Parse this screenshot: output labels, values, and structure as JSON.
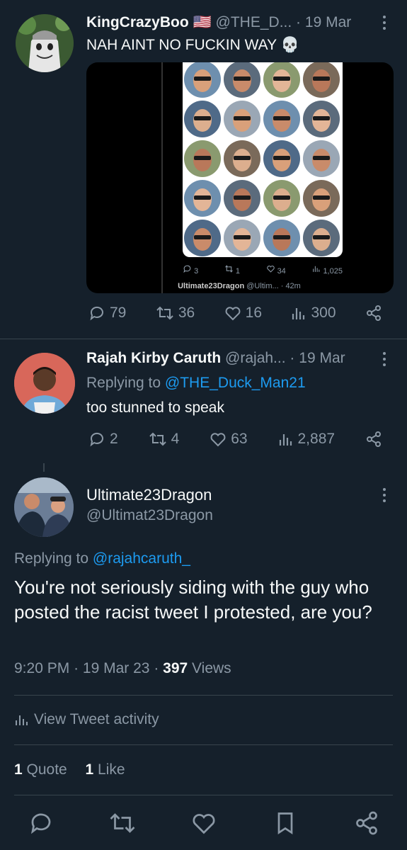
{
  "tweet1": {
    "display_name": "KingCrazyBoo",
    "flag": "🇺🇸",
    "handle": "@THE_D...",
    "dot": "·",
    "date": "19 Mar",
    "text": "NAH AINT NO FUCKIN WAY 💀",
    "embedded": {
      "stats": {
        "replies": "3",
        "retweets": "1",
        "likes": "34",
        "views": "1,025"
      },
      "next_name": "Ultimate23Dragon",
      "next_handle": "@Ultim...",
      "next_time": "· 42m"
    },
    "stats": {
      "replies": "79",
      "retweets": "36",
      "likes": "16",
      "views": "300"
    }
  },
  "tweet2": {
    "display_name": "Rajah Kirby Caruth",
    "handle": "@rajah...",
    "dot": "·",
    "date": "19 Mar",
    "replying_prefix": "Replying to",
    "replying_handle": "@THE_Duck_Man21",
    "text": "too stunned to speak",
    "stats": {
      "replies": "2",
      "retweets": "4",
      "likes": "63",
      "views": "2,887"
    }
  },
  "main": {
    "display_name": "Ultimate23Dragon",
    "handle": "@Ultimat23Dragon",
    "replying_prefix": "Replying to",
    "replying_handle": "@rajahcaruth_",
    "text": "You're not seriously siding with the guy who posted the racist tweet I protested, are you?",
    "time": "9:20 PM",
    "date": "19 Mar 23",
    "dot": "·",
    "views_count": "397",
    "views_label": "Views",
    "activity_label": "View Tweet activity",
    "quote_count": "1",
    "quote_label": "Quote",
    "like_count": "1",
    "like_label": "Like"
  },
  "colors": {
    "background": "#15202b",
    "text": "#f7f9f9",
    "muted": "#8b98a5",
    "link": "#1d9bf0",
    "border": "#38444d"
  }
}
